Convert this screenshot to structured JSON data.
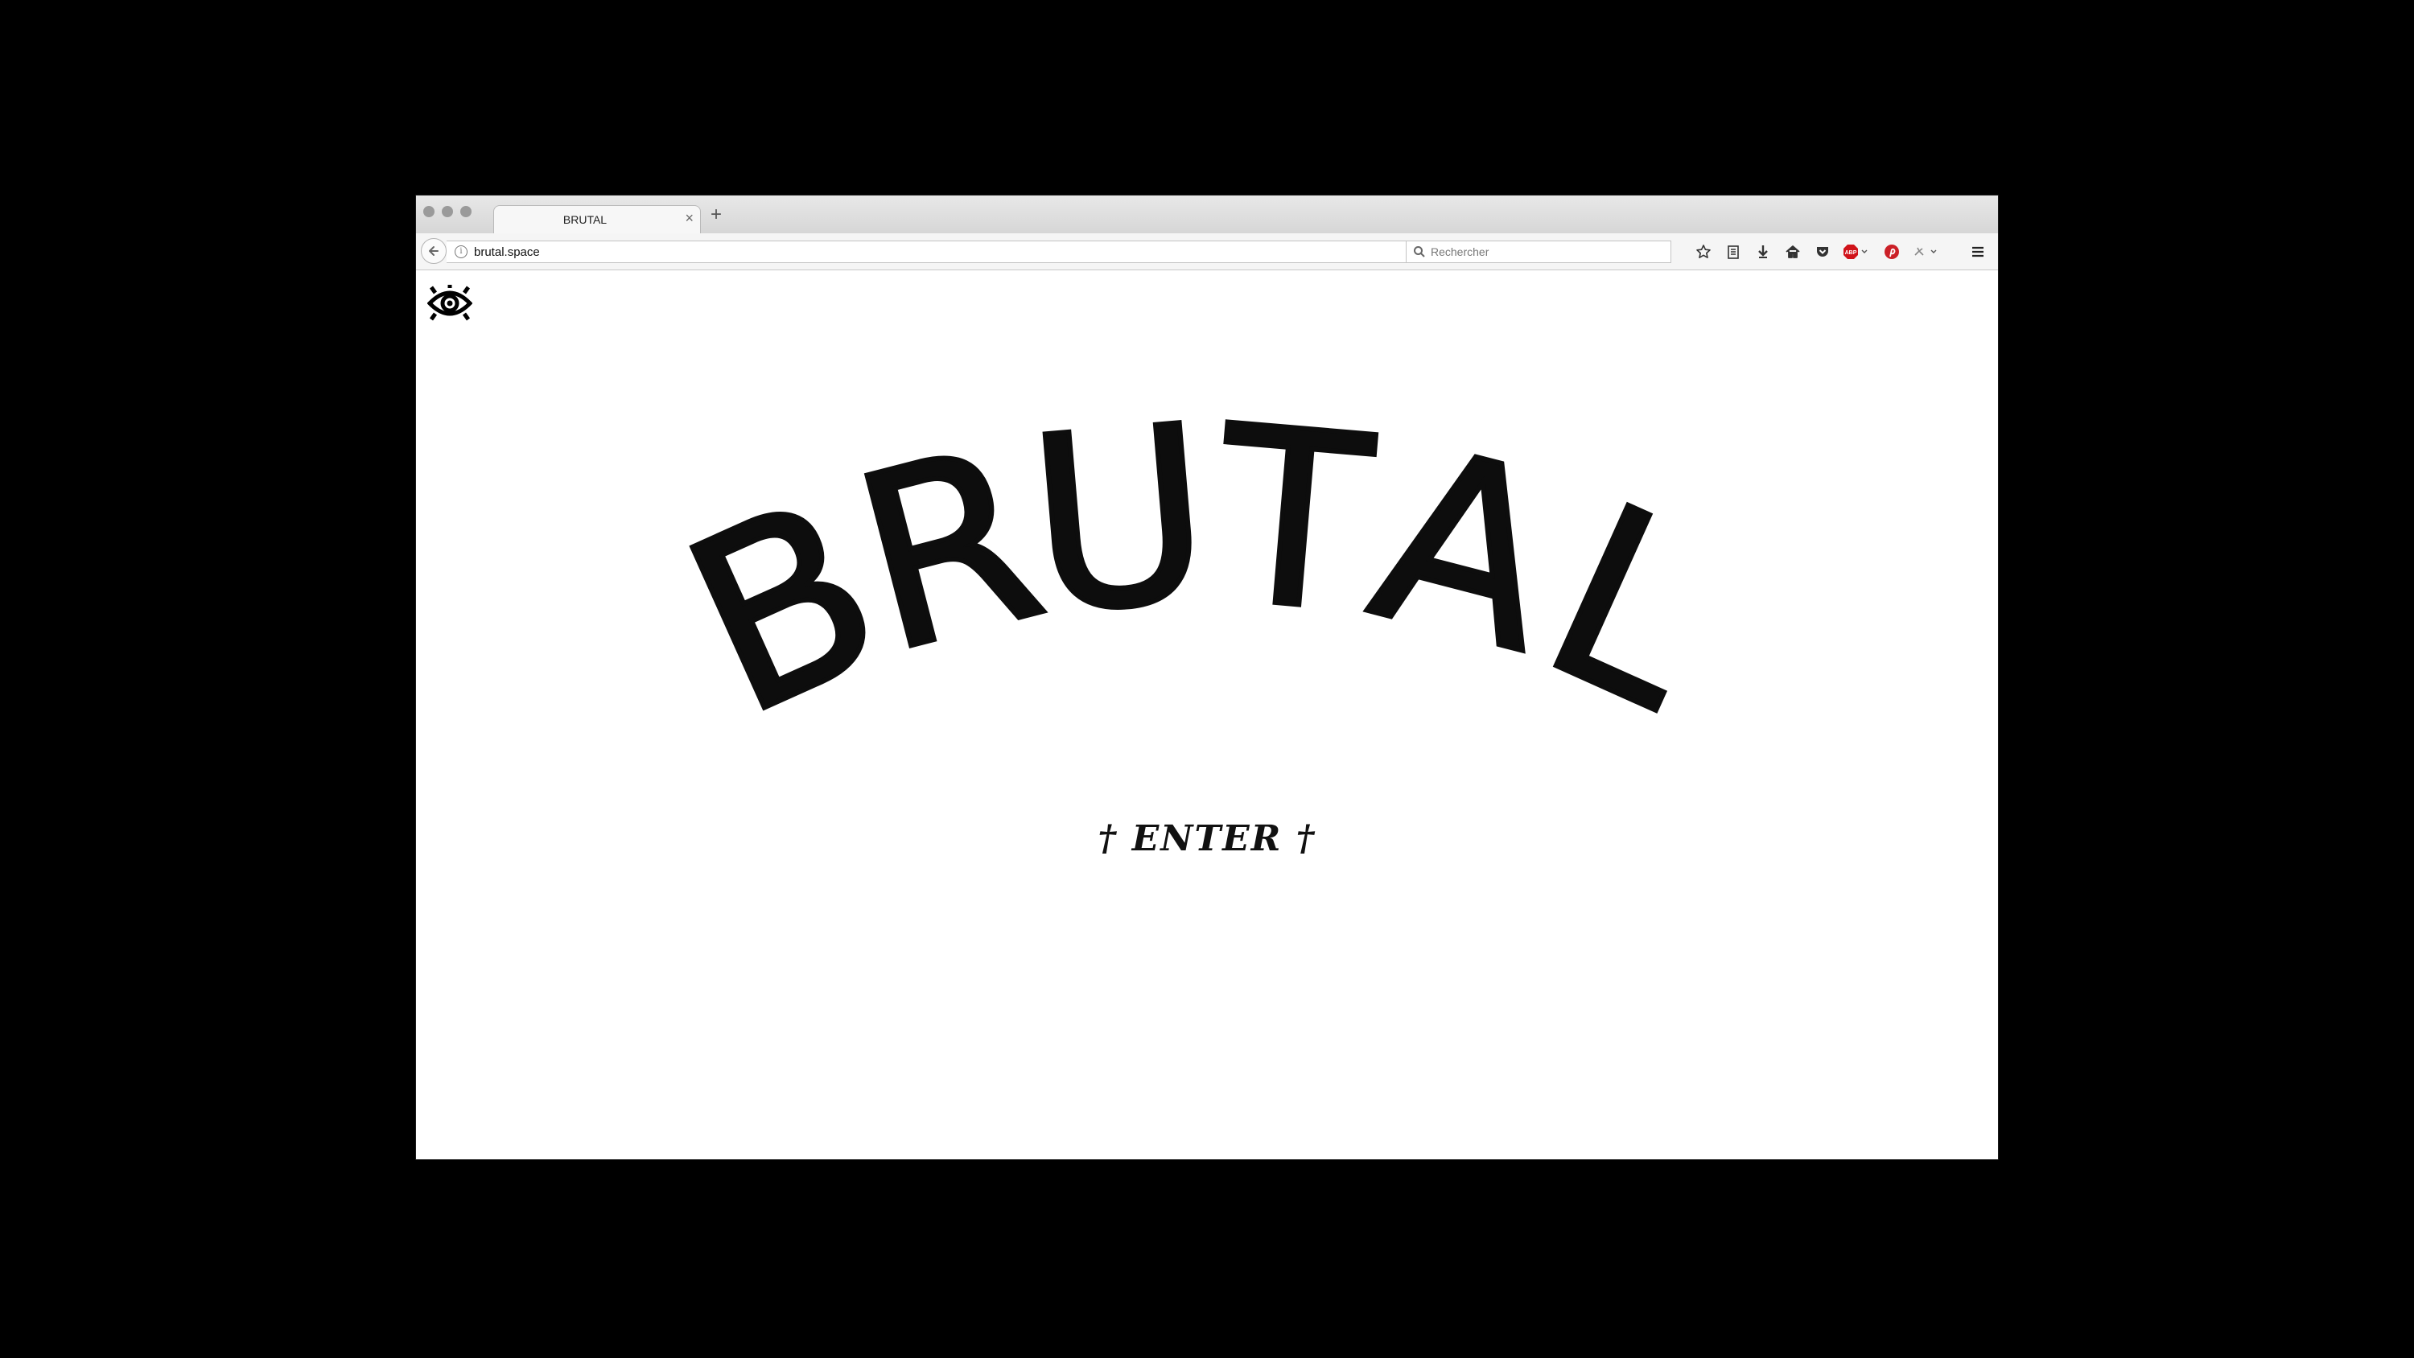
{
  "browser": {
    "tab_title": "BRUTAL",
    "tab_close": "×",
    "new_tab": "+",
    "url": "brutal.space",
    "search_placeholder": "Rechercher",
    "toolbar_icons": [
      "star-icon",
      "reading-list-icon",
      "download-icon",
      "home-icon",
      "pocket-icon",
      "adblock-icon",
      "pinterest-icon",
      "extension-icon",
      "menu-icon"
    ],
    "adblock_badge": "ABP"
  },
  "page": {
    "title_letters": [
      "B",
      "R",
      "U",
      "T",
      "A",
      "L"
    ],
    "enter_label": "† ENTER †"
  },
  "colors": {
    "backdrop": "#000000",
    "page_bg": "#ffffff",
    "ink": "#111111",
    "adblock_red": "#d0131a",
    "pinterest_red": "#cb2027"
  }
}
